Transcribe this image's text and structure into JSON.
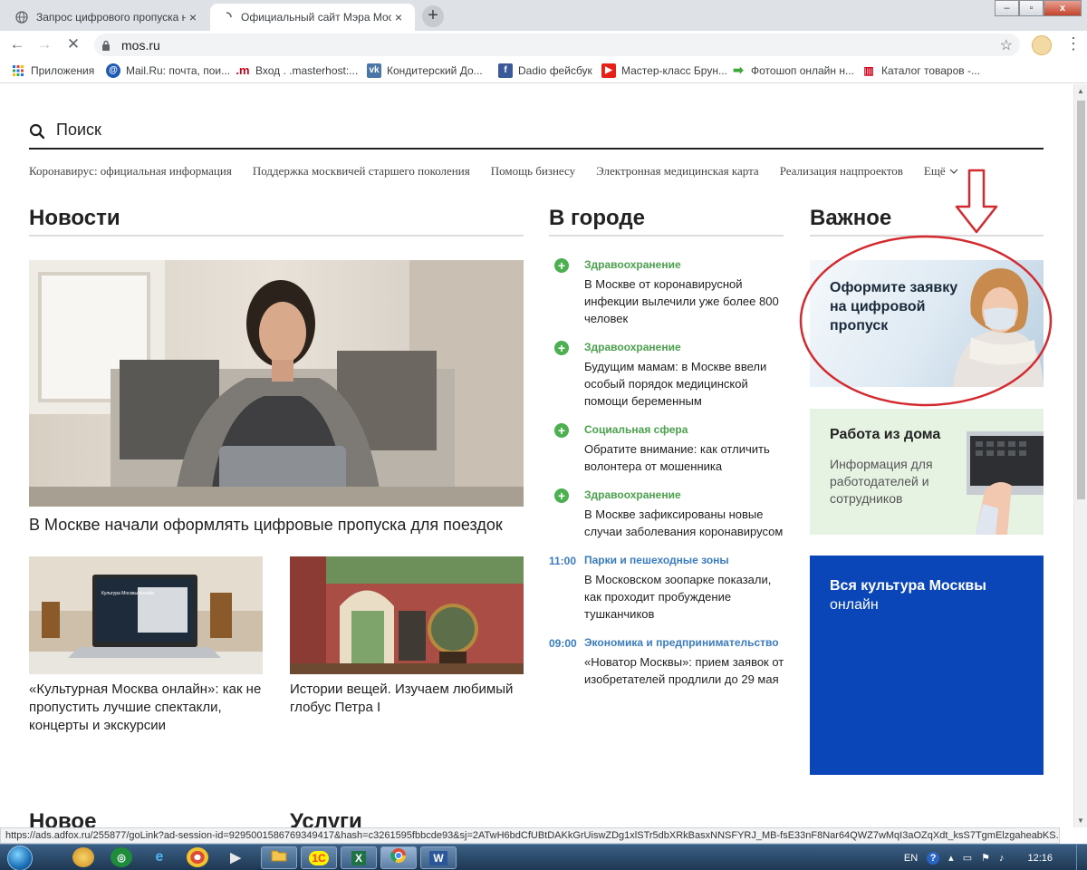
{
  "browser": {
    "tabs": [
      {
        "title": "Запрос цифрового пропуска на",
        "active": false
      },
      {
        "title": "Официальный сайт Мэра Моск",
        "active": true
      }
    ],
    "new_tab_label": "+",
    "url": "mos.ru",
    "bookmarks": [
      {
        "label": "Приложения",
        "icon": "apps-grid-icon"
      },
      {
        "label": "Mail.Ru: почта, пои...",
        "icon": "mailru-icon"
      },
      {
        "label": "Вход . .masterhost:...",
        "icon": "masterhost-icon"
      },
      {
        "label": "Кондитерский До...",
        "icon": "vk-icon"
      },
      {
        "label": "Dadio фейсбук",
        "icon": "facebook-icon"
      },
      {
        "label": "Мастер-класс Брун...",
        "icon": "youtube-icon"
      },
      {
        "label": "Фотошоп онлайн н...",
        "icon": "arrow-bookmark-icon"
      },
      {
        "label": "Каталог товаров -...",
        "icon": "catalog-icon"
      }
    ],
    "status_url": "https://ads.adfox.ru/255877/goLink?ad-session-id=9295001586769349417&hash=c3261595fbbcde93&sj=2ATwH6bdCfUBtDAKkGrUiswZDg1xlSTr5dbXRkBasxNNSFYRJ_MB-fsE33nF8Nar64QWZ7wMqI3aOZqXdt_ksS7TgmElzgaheabKS..."
  },
  "page": {
    "search": {
      "placeholder": "Поиск"
    },
    "topnav": [
      "Коронавирус: официальная информация",
      "Поддержка москвичей старшего поколения",
      "Помощь бизнесу",
      "Электронная медицинская карта",
      "Реализация нацпроектов"
    ],
    "topnav_more": "Ещё",
    "columns": {
      "news": "Новости",
      "city": "В городе",
      "important": "Важное"
    },
    "main_news": {
      "headline": "В Москве начали оформлять цифровые пропуска для поездок"
    },
    "secondary_news": [
      {
        "caption": "«Культурная Москва онлайн»: как не пропустить лучшие спектакли, концерты и экскурсии",
        "screen_text": "Культура Москвы онлайн"
      },
      {
        "caption": "Истории вещей. Изучаем любимый глобус Петра I"
      }
    ],
    "city_news": [
      {
        "marker": "plus",
        "time": "",
        "category": "Здравоохранение",
        "text": "В Москве от коронавирусной инфекции вылечили уже более 800 человек"
      },
      {
        "marker": "plus",
        "time": "",
        "category": "Здравоохранение",
        "text": "Будущим мамам: в Москве ввели особый порядок медицинской помощи беременным"
      },
      {
        "marker": "plus",
        "time": "",
        "category": "Социальная сфера",
        "text": "Обратите внимание: как отличить волонтера от мошенника"
      },
      {
        "marker": "plus",
        "time": "",
        "category": "Здравоохранение",
        "text": "В Москве зафиксированы новые случаи заболевания коронавирусом"
      },
      {
        "marker": "time",
        "time": "11:00",
        "category": "Парки и пешеходные зоны",
        "text": "В Московском зоопарке показали, как проходит пробуждение тушканчиков"
      },
      {
        "marker": "time",
        "time": "09:00",
        "category": "Экономика и предпринимательство",
        "text": "«Новатор Москвы»: прием заявок от изобретателей продлили до 29 мая"
      }
    ],
    "banners": [
      {
        "title": "Оформите заявку на цифровой пропуск"
      },
      {
        "title": "Работа из дома",
        "subtitle": "Информация для работодателей и сотрудников"
      },
      {
        "title": "Вся культура Москвы",
        "subtitle": "онлайн"
      }
    ],
    "lower_sections": [
      "Новое",
      "Услуги"
    ]
  },
  "taskbar": {
    "apps": [
      "1С",
      "X",
      "W"
    ],
    "language": "EN",
    "clock": "12:16"
  },
  "colors": {
    "green_category": "#4aa24d",
    "blue_time": "#3a7cc1",
    "culture_banner": "#0a46b8",
    "annotation_red": "#d32a2f"
  }
}
